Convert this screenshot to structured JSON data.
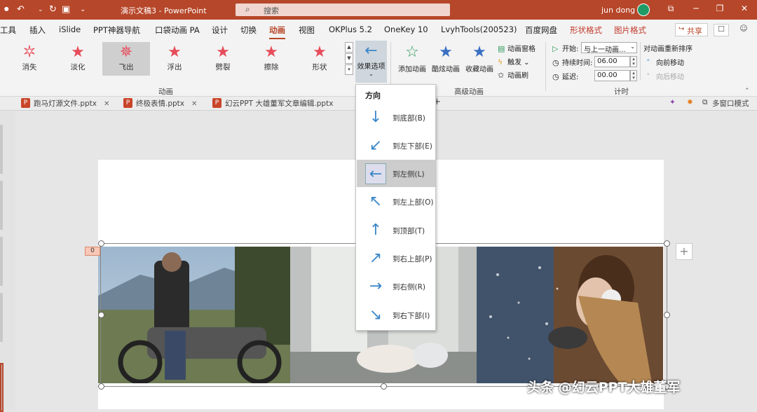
{
  "titlebar": {
    "doc_title": "演示文稿3  -  PowerPoint",
    "search_placeholder": "搜索",
    "user_name": "jun dong"
  },
  "tabs": [
    "工具",
    "插入",
    "iSlide",
    "PPT神器导航",
    "口袋动画 PA",
    "设计",
    "切换",
    "动画",
    "视图",
    "OKPlus 5.2",
    "OneKey 10",
    "LvyhTools(200523)",
    "百度网盘",
    "形状格式",
    "图片格式"
  ],
  "share_label": "共享",
  "animations": [
    {
      "label": "消失",
      "color": "#ffffff"
    },
    {
      "label": "淡化",
      "color": "#e74c5a"
    },
    {
      "label": "飞出",
      "color": "#e74c5a"
    },
    {
      "label": "浮出",
      "color": "#e74c5a"
    },
    {
      "label": "劈裂",
      "color": "#e74c5a"
    },
    {
      "label": "擦除",
      "color": "#e74c5a"
    },
    {
      "label": "形状",
      "color": "#e74c5a"
    }
  ],
  "group_labels": {
    "animation": "动画",
    "advanced": "高级动画",
    "timing": "计时"
  },
  "effect_options": {
    "label": "效果选项"
  },
  "advanced": {
    "add": "添加动画",
    "cool": "酷炫动画",
    "fav": "收藏动画",
    "pane": "动画窗格",
    "trigger": "触发",
    "brush": "动画刷"
  },
  "timing": {
    "start_label": "开始:",
    "start_value": "与上一动画...",
    "duration_label": "持续时间:",
    "duration_value": "06.00",
    "delay_label": "延迟:",
    "delay_value": "00.00",
    "reorder_title": "对动画重新排序",
    "move_earlier": "向前移动",
    "move_later": "向后移动"
  },
  "doc_tabs": [
    "跑马灯源文件.pptx",
    "终极表情.pptx",
    "幻云PPT 大雄董军文章编辑.pptx"
  ],
  "multi_window": "多窗口模式",
  "direction_menu": {
    "title": "方向",
    "items": [
      {
        "label": "到底部(B)",
        "arrow": "↓"
      },
      {
        "label": "到左下部(E)",
        "arrow": "↙"
      },
      {
        "label": "到左侧(L)",
        "arrow": "←"
      },
      {
        "label": "到左上部(O)",
        "arrow": "↖"
      },
      {
        "label": "到顶部(T)",
        "arrow": "↑"
      },
      {
        "label": "到右上部(P)",
        "arrow": "↗"
      },
      {
        "label": "到右侧(R)",
        "arrow": "→"
      },
      {
        "label": "到右下部(I)",
        "arrow": "↘"
      }
    ],
    "selected_index": 2
  },
  "anim_tag": "0",
  "watermark": "头条 @幻云PPT大雄董军",
  "colors": {
    "accent": "#b7472a",
    "arrow_blue": "#3a87c9"
  }
}
